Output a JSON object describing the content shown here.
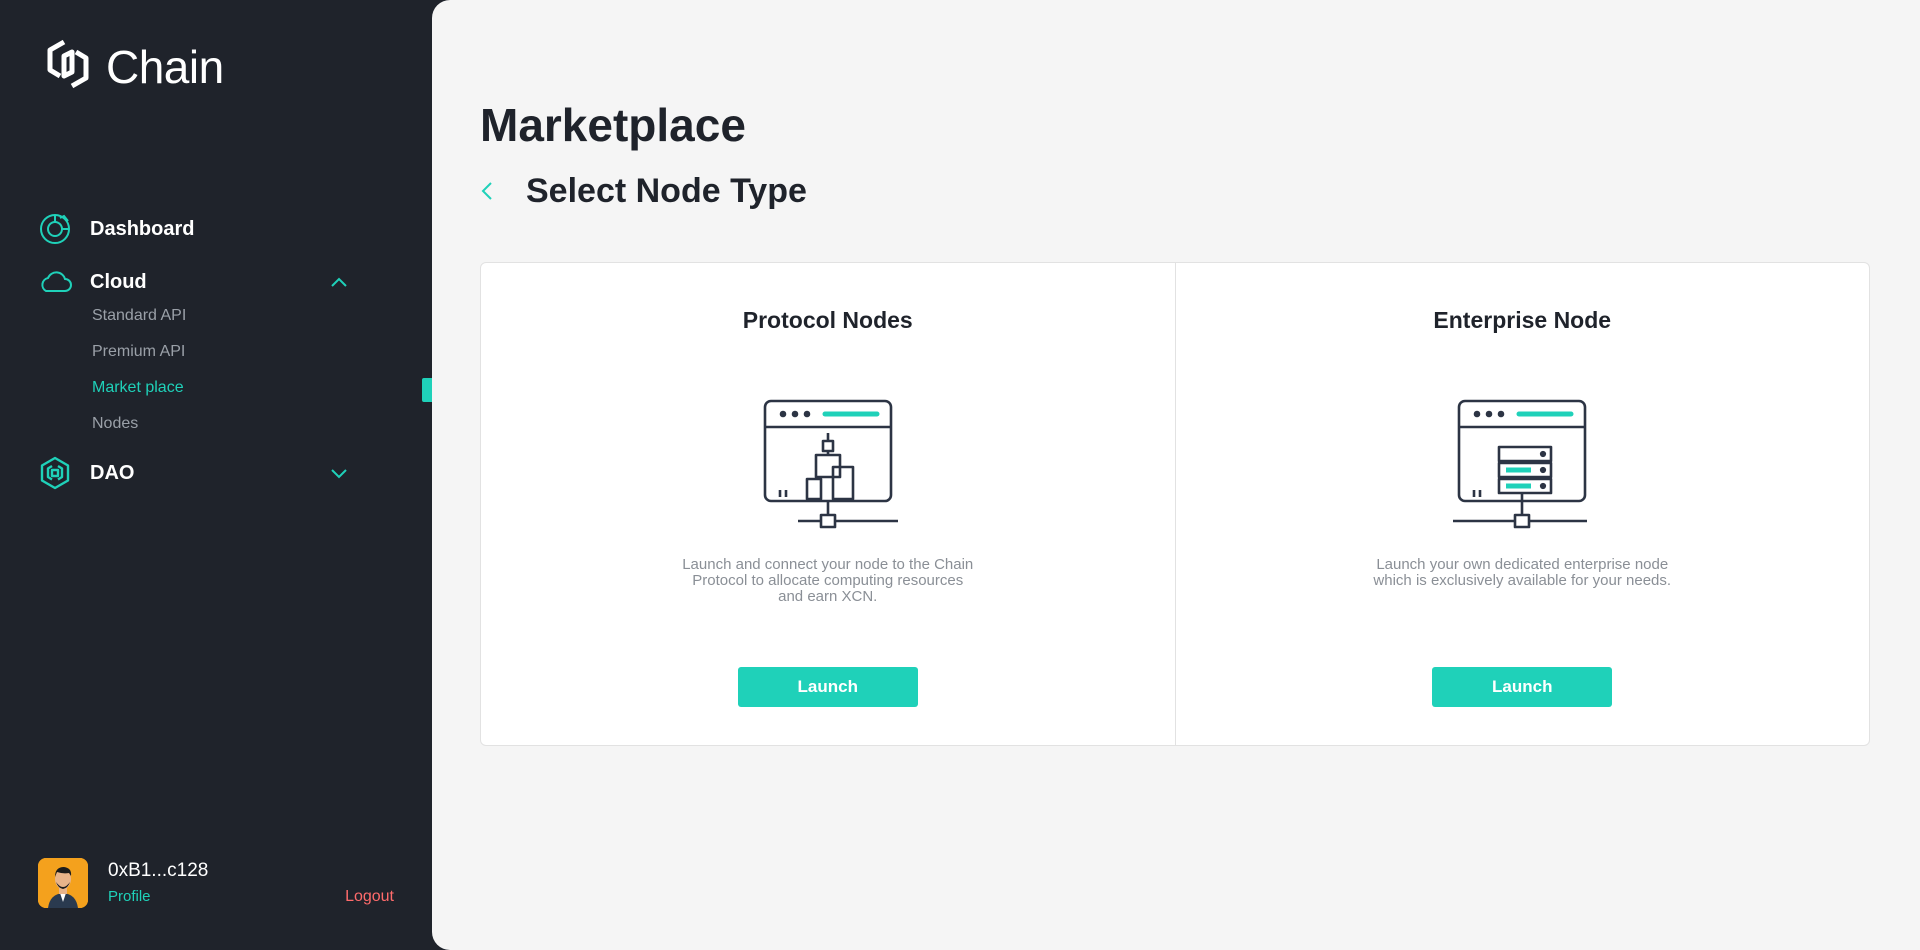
{
  "app": {
    "brand": "Chain",
    "accent_color": "#1fd1b9",
    "sidebar_bg": "#1f232b",
    "danger_color": "#ff6b6b"
  },
  "sidebar": {
    "nav": [
      {
        "label": "Dashboard",
        "icon": "dashboard-icon"
      },
      {
        "label": "Cloud",
        "icon": "cloud-icon",
        "expanded": true,
        "sub": [
          {
            "label": "Standard API",
            "active": false
          },
          {
            "label": "Premium API",
            "active": false
          },
          {
            "label": "Market place",
            "active": true
          },
          {
            "label": "Nodes",
            "active": false
          }
        ]
      },
      {
        "label": "DAO",
        "icon": "dao-icon",
        "expanded": false
      }
    ],
    "user": {
      "address": "0xB1...c128",
      "profile_label": "Profile",
      "logout_label": "Logout"
    }
  },
  "main": {
    "title": "Marketplace",
    "subtitle": "Select Node Type",
    "cards": [
      {
        "title": "Protocol Nodes",
        "icon": "protocol-node-illustration",
        "description": "Launch and connect your node to the Chain Protocol to allocate computing resources and earn XCN.",
        "button": "Launch"
      },
      {
        "title": "Enterprise Node",
        "icon": "enterprise-node-illustration",
        "description": "Launch your own dedicated enterprise node which is exclusively available for your needs.",
        "button": "Launch"
      }
    ]
  }
}
